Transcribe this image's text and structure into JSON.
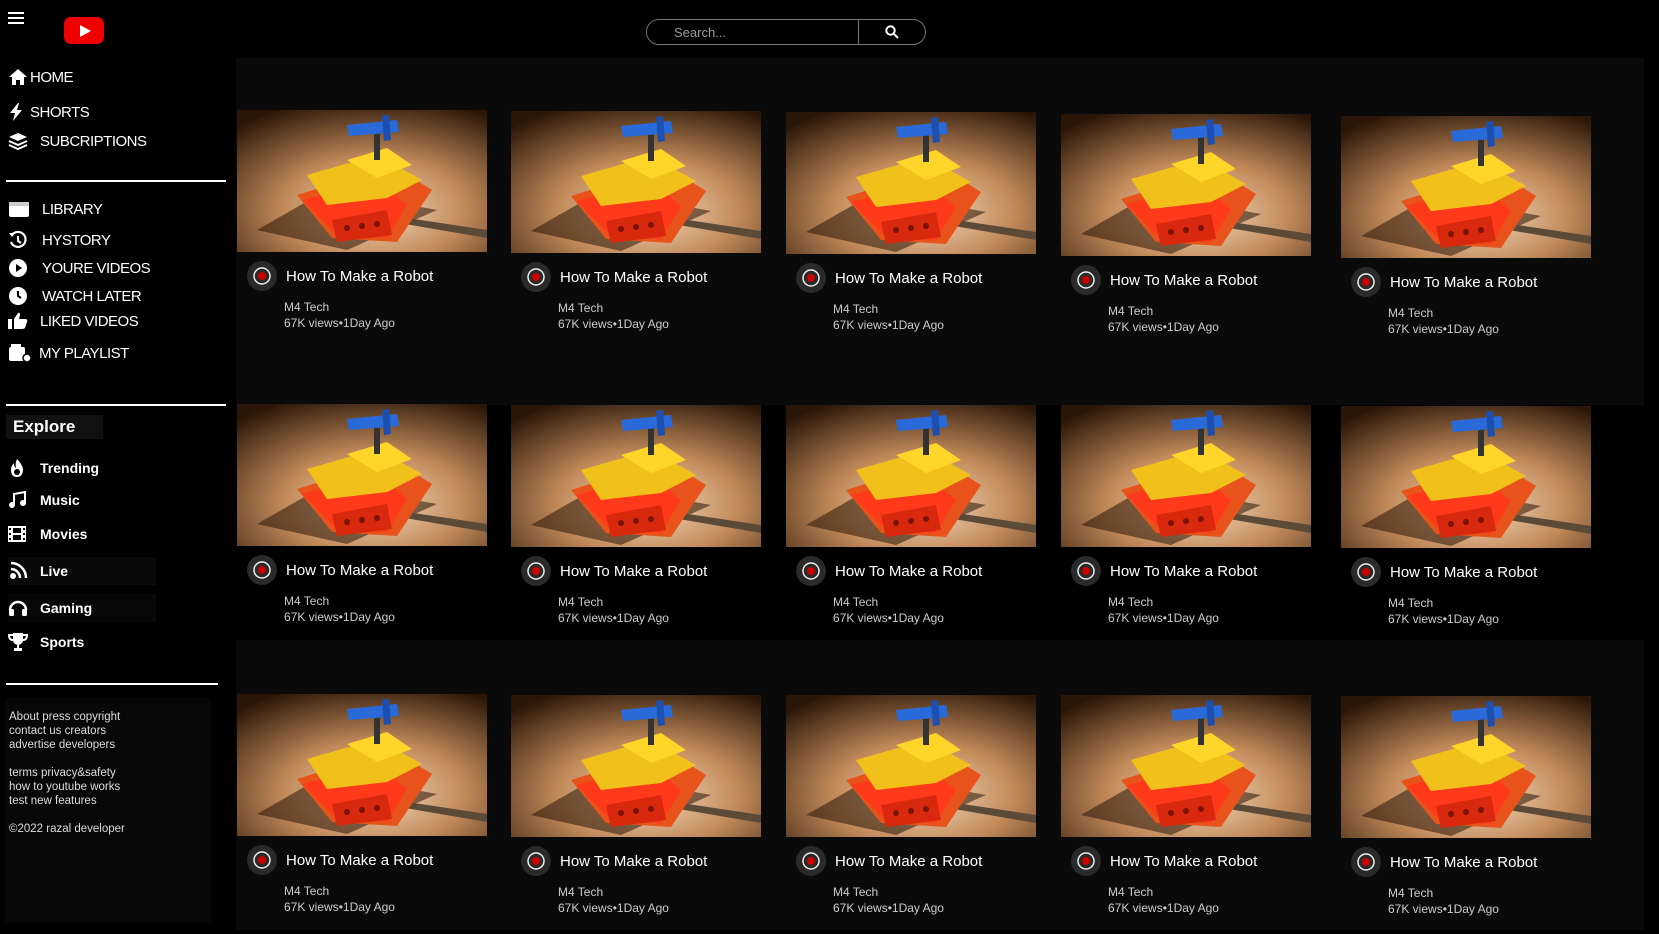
{
  "header": {
    "search_placeholder": "Search..."
  },
  "sidebar": {
    "items": [
      {
        "label": "HOME",
        "icon": "home-icon"
      },
      {
        "label": "SHORTS",
        "icon": "shorts-icon"
      },
      {
        "label": "SUBCRIPTIONS",
        "icon": "subscriptions-icon"
      },
      {
        "label": "LIBRARY",
        "icon": "library-icon"
      },
      {
        "label": "HYSTORY",
        "icon": "history-icon"
      },
      {
        "label": "YOURE VIDEOS",
        "icon": "play-circle-icon"
      },
      {
        "label": "WATCH LATER",
        "icon": "clock-icon"
      },
      {
        "label": "LIKED VIDEOS",
        "icon": "thumbs-up-icon"
      },
      {
        "label": "MY PLAYLIST",
        "icon": "playlist-icon"
      }
    ],
    "explore_title": "Explore",
    "explore": [
      {
        "label": "Trending",
        "icon": "fire-icon"
      },
      {
        "label": "Music",
        "icon": "music-icon"
      },
      {
        "label": "Movies",
        "icon": "film-icon"
      },
      {
        "label": "Live",
        "icon": "broadcast-icon"
      },
      {
        "label": "Gaming",
        "icon": "headset-icon"
      },
      {
        "label": "Sports",
        "icon": "trophy-icon"
      }
    ],
    "footer": {
      "line1": "About press copyright",
      "line2": "contact us creators",
      "line3": "advertise developers",
      "line4": "terms privacy&safety",
      "line5": "how to youtube works",
      "line6": "test new features",
      "line7": "©2022 razal developer"
    }
  },
  "videos": [
    {
      "title": "How To Make a Robot",
      "channel": "M4 Tech",
      "stats": "67K views•1Day Ago"
    },
    {
      "title": "How To Make a Robot",
      "channel": "M4 Tech",
      "stats": "67K views•1Day Ago"
    },
    {
      "title": "How To Make a Robot",
      "channel": "M4 Tech",
      "stats": "67K views•1Day Ago"
    },
    {
      "title": "How To Make a Robot",
      "channel": "M4 Tech",
      "stats": "67K views•1Day Ago"
    },
    {
      "title": "How To Make a Robot",
      "channel": "M4 Tech",
      "stats": "67K views•1Day Ago"
    },
    {
      "title": "How To Make a Robot",
      "channel": "M4 Tech",
      "stats": "67K views•1Day Ago"
    },
    {
      "title": "How To Make a Robot",
      "channel": "M4 Tech",
      "stats": "67K views•1Day Ago"
    },
    {
      "title": "How To Make a Robot",
      "channel": "M4 Tech",
      "stats": "67K views•1Day Ago"
    },
    {
      "title": "How To Make a Robot",
      "channel": "M4 Tech",
      "stats": "67K views•1Day Ago"
    },
    {
      "title": "How To Make a Robot",
      "channel": "M4 Tech",
      "stats": "67K views•1Day Ago"
    },
    {
      "title": "How To Make a Robot",
      "channel": "M4 Tech",
      "stats": "67K views•1Day Ago"
    },
    {
      "title": "How To Make a Robot",
      "channel": "M4 Tech",
      "stats": "67K views•1Day Ago"
    },
    {
      "title": "How To Make a Robot",
      "channel": "M4 Tech",
      "stats": "67K views•1Day Ago"
    },
    {
      "title": "How To Make a Robot",
      "channel": "M4 Tech",
      "stats": "67K views•1Day Ago"
    },
    {
      "title": "How To Make a Robot",
      "channel": "M4 Tech",
      "stats": "67K views•1Day Ago"
    }
  ],
  "colors": {
    "brand": "#ee0000",
    "background": "#000000"
  }
}
